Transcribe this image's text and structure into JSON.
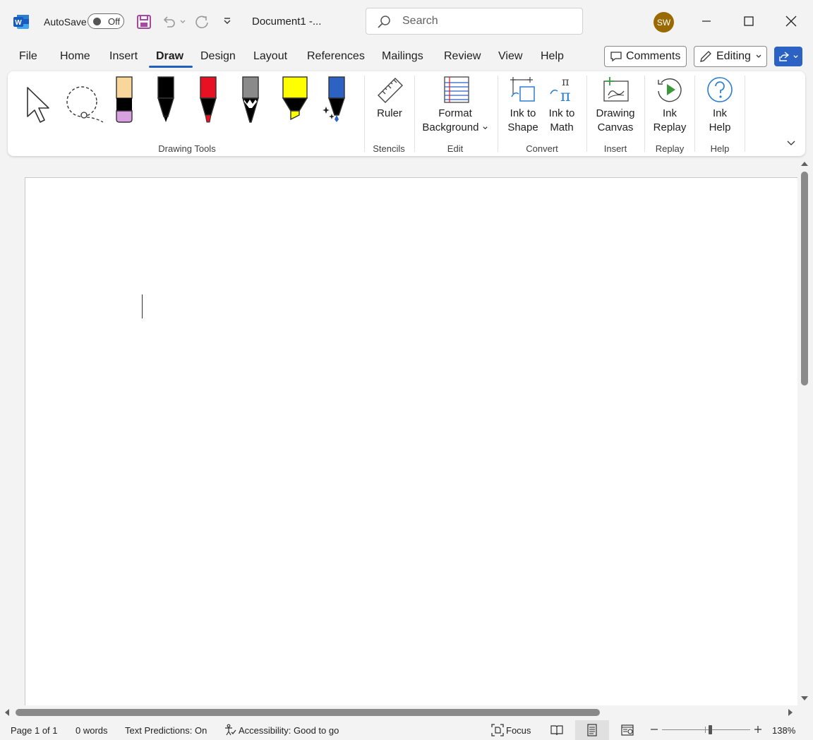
{
  "titlebar": {
    "autosave_label": "AutoSave",
    "autosave_state": "Off",
    "doc_title": "Document1  -...",
    "search_placeholder": "Search",
    "user_initials": "SW",
    "avatar_color": "#9a6a00"
  },
  "tabs": [
    "File",
    "Home",
    "Insert",
    "Draw",
    "Design",
    "Layout",
    "References",
    "Mailings",
    "Review",
    "View",
    "Help"
  ],
  "active_tab": "Draw",
  "right_buttons": {
    "comments": "Comments",
    "editing": "Editing"
  },
  "ribbon": {
    "groups": {
      "drawing_tools": "Drawing Tools",
      "stencils": "Stencils",
      "edit": "Edit",
      "convert": "Convert",
      "insert": "Insert",
      "replay": "Replay",
      "help": "Help"
    },
    "buttons": {
      "ruler": "Ruler",
      "format_background_1": "Format",
      "format_background_2": "Background",
      "ink_to_shape_1": "Ink to",
      "ink_to_shape_2": "Shape",
      "ink_to_math_1": "Ink to",
      "ink_to_math_2": "Math",
      "drawing_canvas_1": "Drawing",
      "drawing_canvas_2": "Canvas",
      "ink_replay_1": "Ink",
      "ink_replay_2": "Replay",
      "ink_help_1": "Ink",
      "ink_help_2": "Help"
    },
    "pen_colors": {
      "black": "#000000",
      "red": "#e81123",
      "gray": "#8a8a8a",
      "yellow": "#ffff00",
      "blue": "#2b62c4",
      "eraser_top": "#f9d79b",
      "eraser_bottom": "#d8a0e0"
    }
  },
  "status": {
    "page": "Page 1 of 1",
    "words": "0 words",
    "text_predictions": "Text Predictions: On",
    "accessibility": "Accessibility: Good to go",
    "focus": "Focus",
    "zoom": "138%"
  },
  "colors": {
    "accent": "#2b62c4",
    "word_blue": "#185abd",
    "save_purple": "#a34ba0"
  }
}
